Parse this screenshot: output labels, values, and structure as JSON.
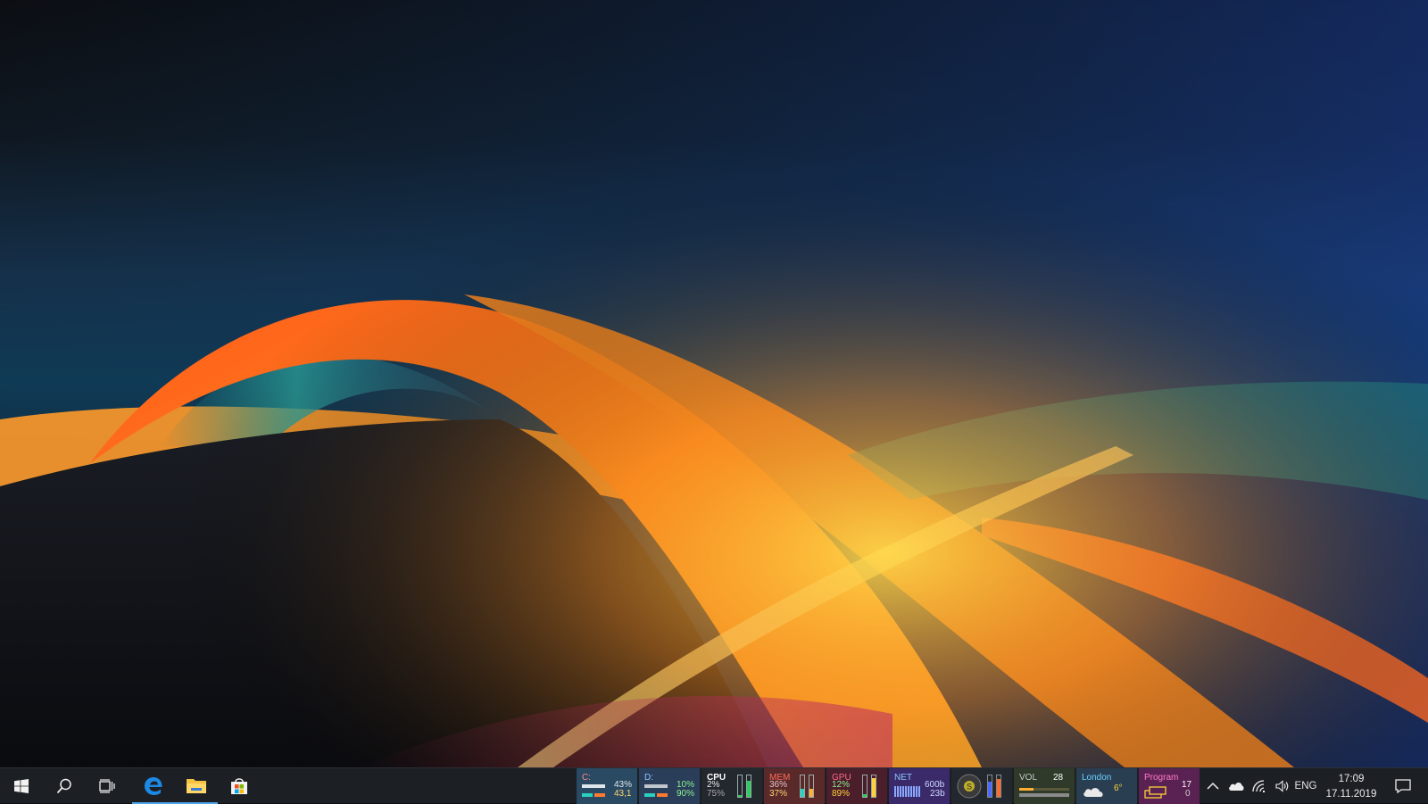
{
  "taskbar": {
    "start_icon": "windows-logo-icon",
    "search_icon": "search-icon",
    "taskview_icon": "task-view-icon",
    "pinned": [
      {
        "name": "edge-icon",
        "active": true
      },
      {
        "name": "file-explorer-icon",
        "active": true
      },
      {
        "name": "store-icon",
        "active": false
      }
    ]
  },
  "monitors": {
    "disk_c": {
      "label": "C:",
      "pct": "43%",
      "value": "43,1",
      "used_fraction": 0.43
    },
    "disk_d": {
      "label": "D:",
      "pct": "10%",
      "value": "90%",
      "used_fraction": 0.1
    },
    "cpu": {
      "label": "CPU",
      "v1": "2%",
      "v2": "75%",
      "bar1": 0.02,
      "bar2": 0.75
    },
    "mem": {
      "label": "MEM",
      "v1": "36%",
      "v2": "37%",
      "bar1": 0.36,
      "bar2": 0.37
    },
    "gpu": {
      "label": "GPU",
      "v1": "12%",
      "v2": "89%",
      "bar1": 0.12,
      "bar2": 0.89
    },
    "net": {
      "label": "NET",
      "v1": "600b",
      "v2": "23b"
    },
    "media": {
      "badge": "S"
    },
    "vol": {
      "label": "VOL",
      "value": "28",
      "level": 0.28
    },
    "weather": {
      "city": "London",
      "temp": "6°",
      "icon": "cloud-icon"
    },
    "program": {
      "label": "Program",
      "v1": "17",
      "v2": "0"
    }
  },
  "tray": {
    "chevron_icon": "chevron-up-icon",
    "onedrive_icon": "cloud-icon",
    "network_icon": "wifi-icon",
    "volume_icon": "speaker-icon",
    "language": "ENG",
    "time": "17:09",
    "date": "17.11.2019",
    "notification_icon": "action-center-icon"
  },
  "colors": {
    "taskbar_bg": "#1c1f24",
    "accent": "#4ea3e8",
    "disk_c_bg": "#2a4a63",
    "disk_d_bg": "#2a3e5a",
    "mem_bg": "#5a2a2a",
    "gpu_bg": "#4a1e2a",
    "net_bg": "#3a2a6a",
    "vol_bg": "#303a2a",
    "weather_bg": "#2a3e52",
    "program_bg": "#5a2252"
  }
}
